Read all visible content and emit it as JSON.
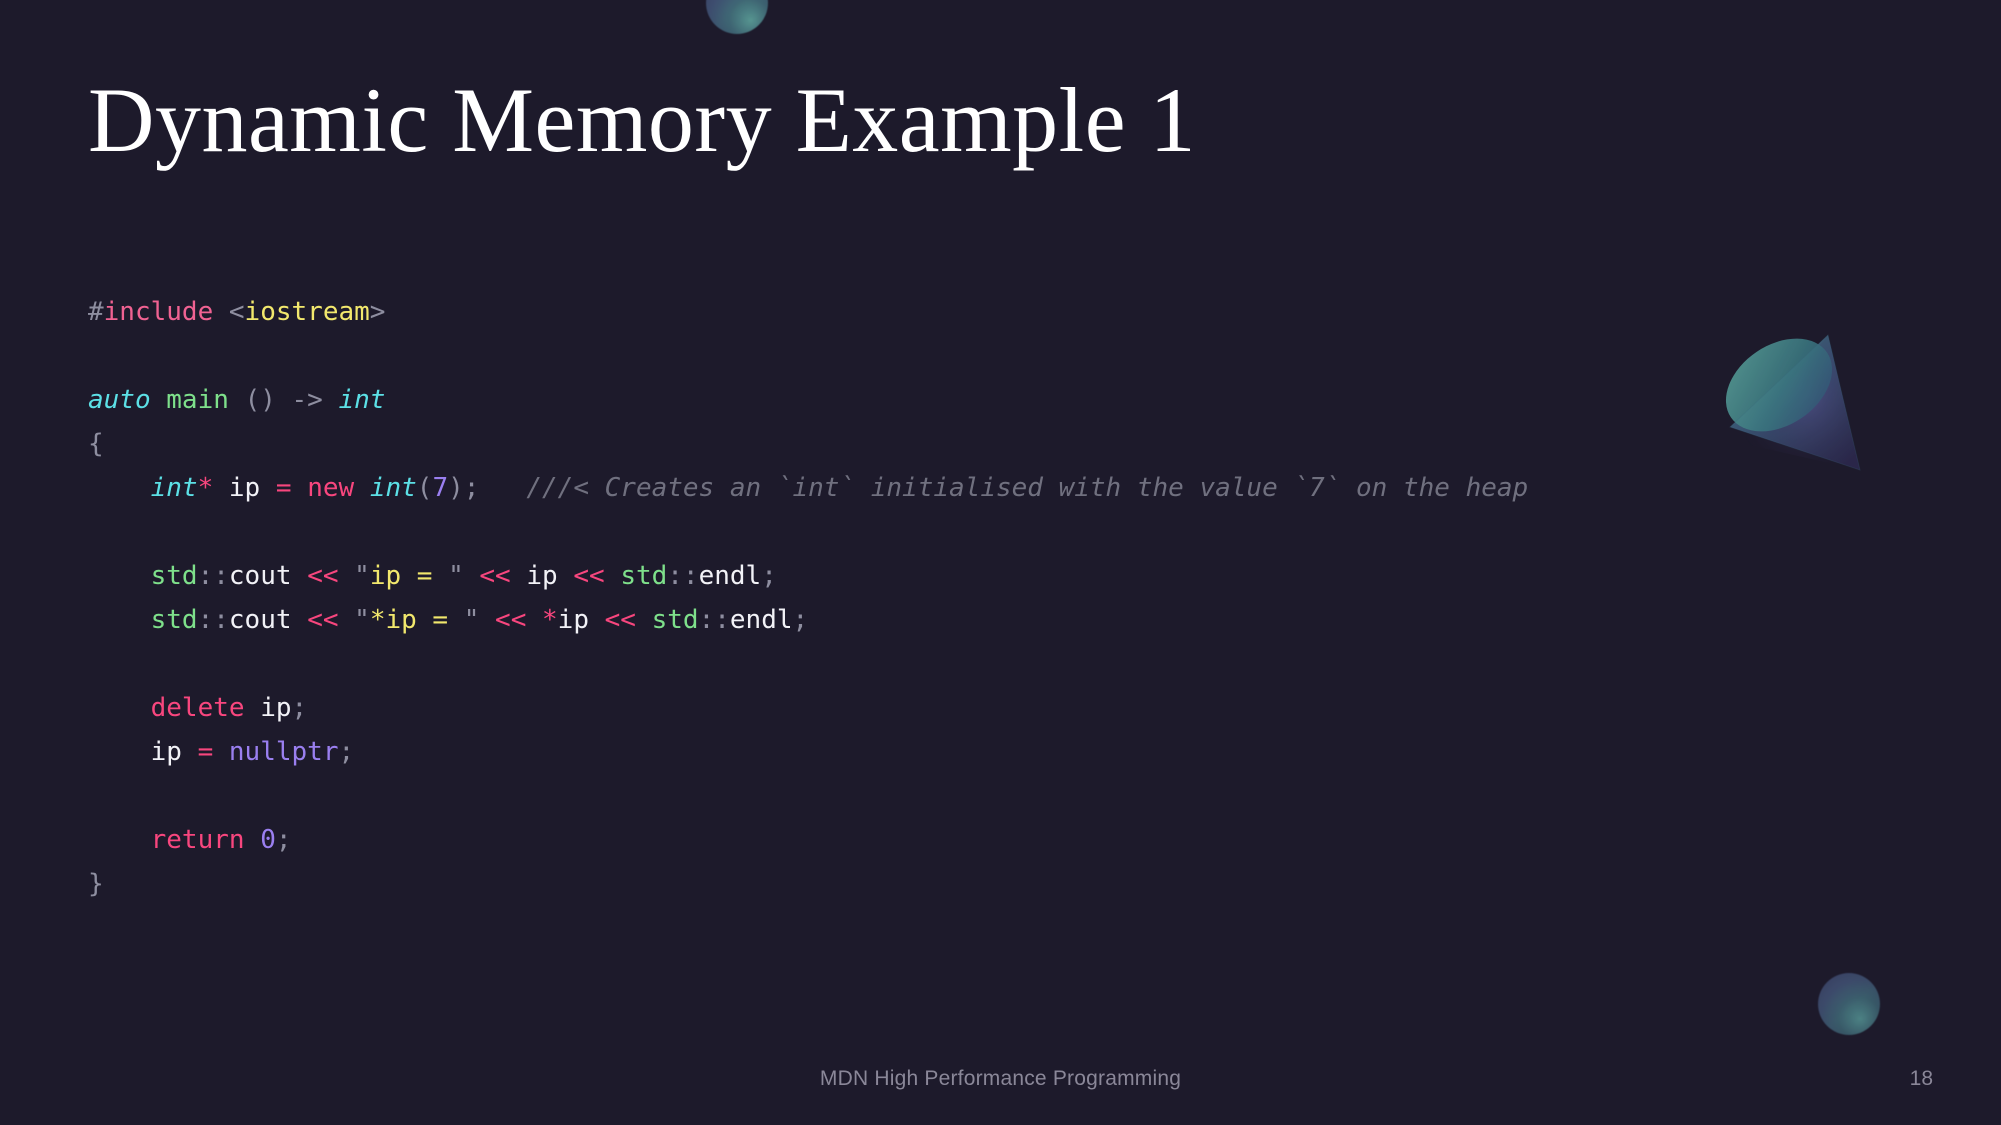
{
  "slide": {
    "title": "Dynamic Memory Example 1",
    "background_color": "#1d1a2b",
    "title_color": "#ffffff"
  },
  "code": {
    "language": "cpp",
    "lines": [
      {
        "tokens": [
          {
            "text": "#",
            "cls": "t-hash"
          },
          {
            "text": "include",
            "cls": "t-pre"
          },
          {
            "text": " ",
            "cls": "t-punct"
          },
          {
            "text": "<",
            "cls": "t-punct"
          },
          {
            "text": "iostream",
            "cls": "t-string"
          },
          {
            "text": ">",
            "cls": "t-punct"
          }
        ]
      },
      {
        "tokens": []
      },
      {
        "tokens": [
          {
            "text": "auto",
            "cls": "t-type"
          },
          {
            "text": " ",
            "cls": "t-punct"
          },
          {
            "text": "main",
            "cls": "t-fn"
          },
          {
            "text": " ",
            "cls": "t-punct"
          },
          {
            "text": "()",
            "cls": "t-punct"
          },
          {
            "text": " ",
            "cls": "t-punct"
          },
          {
            "text": "->",
            "cls": "t-punct"
          },
          {
            "text": " ",
            "cls": "t-punct"
          },
          {
            "text": "int",
            "cls": "t-type"
          }
        ]
      },
      {
        "tokens": [
          {
            "text": "{",
            "cls": "t-punct"
          }
        ]
      },
      {
        "tokens": [
          {
            "text": "    ",
            "cls": "t-punct"
          },
          {
            "text": "int",
            "cls": "t-type"
          },
          {
            "text": "*",
            "cls": "t-op"
          },
          {
            "text": " ",
            "cls": "t-punct"
          },
          {
            "text": "ip",
            "cls": "t-var"
          },
          {
            "text": " ",
            "cls": "t-punct"
          },
          {
            "text": "=",
            "cls": "t-op"
          },
          {
            "text": " ",
            "cls": "t-punct"
          },
          {
            "text": "new",
            "cls": "t-kw"
          },
          {
            "text": " ",
            "cls": "t-punct"
          },
          {
            "text": "int",
            "cls": "t-type"
          },
          {
            "text": "(",
            "cls": "t-punct"
          },
          {
            "text": "7",
            "cls": "t-num"
          },
          {
            "text": ");",
            "cls": "t-punct"
          },
          {
            "text": "   ",
            "cls": "t-punct"
          },
          {
            "text": "///< Creates an `int` initialised with the value `7` on the heap",
            "cls": "t-comment"
          }
        ]
      },
      {
        "tokens": []
      },
      {
        "tokens": [
          {
            "text": "    ",
            "cls": "t-punct"
          },
          {
            "text": "std",
            "cls": "t-ns"
          },
          {
            "text": "::",
            "cls": "t-punct"
          },
          {
            "text": "cout",
            "cls": "t-var"
          },
          {
            "text": " ",
            "cls": "t-punct"
          },
          {
            "text": "<<",
            "cls": "t-op"
          },
          {
            "text": " ",
            "cls": "t-punct"
          },
          {
            "text": "\"",
            "cls": "t-punct"
          },
          {
            "text": "ip = ",
            "cls": "t-string"
          },
          {
            "text": "\"",
            "cls": "t-punct"
          },
          {
            "text": " ",
            "cls": "t-punct"
          },
          {
            "text": "<<",
            "cls": "t-op"
          },
          {
            "text": " ",
            "cls": "t-punct"
          },
          {
            "text": "ip",
            "cls": "t-var"
          },
          {
            "text": " ",
            "cls": "t-punct"
          },
          {
            "text": "<<",
            "cls": "t-op"
          },
          {
            "text": " ",
            "cls": "t-punct"
          },
          {
            "text": "std",
            "cls": "t-ns"
          },
          {
            "text": "::",
            "cls": "t-punct"
          },
          {
            "text": "endl",
            "cls": "t-var"
          },
          {
            "text": ";",
            "cls": "t-punct"
          }
        ]
      },
      {
        "tokens": [
          {
            "text": "    ",
            "cls": "t-punct"
          },
          {
            "text": "std",
            "cls": "t-ns"
          },
          {
            "text": "::",
            "cls": "t-punct"
          },
          {
            "text": "cout",
            "cls": "t-var"
          },
          {
            "text": " ",
            "cls": "t-punct"
          },
          {
            "text": "<<",
            "cls": "t-op"
          },
          {
            "text": " ",
            "cls": "t-punct"
          },
          {
            "text": "\"",
            "cls": "t-punct"
          },
          {
            "text": "*ip = ",
            "cls": "t-string"
          },
          {
            "text": "\"",
            "cls": "t-punct"
          },
          {
            "text": " ",
            "cls": "t-punct"
          },
          {
            "text": "<<",
            "cls": "t-op"
          },
          {
            "text": " ",
            "cls": "t-punct"
          },
          {
            "text": "*",
            "cls": "t-op"
          },
          {
            "text": "ip",
            "cls": "t-var"
          },
          {
            "text": " ",
            "cls": "t-punct"
          },
          {
            "text": "<<",
            "cls": "t-op"
          },
          {
            "text": " ",
            "cls": "t-punct"
          },
          {
            "text": "std",
            "cls": "t-ns"
          },
          {
            "text": "::",
            "cls": "t-punct"
          },
          {
            "text": "endl",
            "cls": "t-var"
          },
          {
            "text": ";",
            "cls": "t-punct"
          }
        ]
      },
      {
        "tokens": []
      },
      {
        "tokens": [
          {
            "text": "    ",
            "cls": "t-punct"
          },
          {
            "text": "delete",
            "cls": "t-kw"
          },
          {
            "text": " ",
            "cls": "t-punct"
          },
          {
            "text": "ip",
            "cls": "t-var"
          },
          {
            "text": ";",
            "cls": "t-punct"
          }
        ]
      },
      {
        "tokens": [
          {
            "text": "    ",
            "cls": "t-punct"
          },
          {
            "text": "ip",
            "cls": "t-var"
          },
          {
            "text": " ",
            "cls": "t-punct"
          },
          {
            "text": "=",
            "cls": "t-op"
          },
          {
            "text": " ",
            "cls": "t-punct"
          },
          {
            "text": "nullptr",
            "cls": "t-num"
          },
          {
            "text": ";",
            "cls": "t-punct"
          }
        ]
      },
      {
        "tokens": []
      },
      {
        "tokens": [
          {
            "text": "    ",
            "cls": "t-punct"
          },
          {
            "text": "return",
            "cls": "t-kw"
          },
          {
            "text": " ",
            "cls": "t-punct"
          },
          {
            "text": "0",
            "cls": "t-num"
          },
          {
            "text": ";",
            "cls": "t-punct"
          }
        ]
      },
      {
        "tokens": [
          {
            "text": "}",
            "cls": "t-punct"
          }
        ]
      }
    ]
  },
  "footer": {
    "text": "MDN High Performance Programming",
    "page_number": "18"
  },
  "decorations": {
    "cone": {
      "name": "cone-shape",
      "gradient_from": "#4f9a94",
      "gradient_to": "#3a3366"
    },
    "sphere_top": {
      "name": "sphere-shape",
      "gradient_from": "#4d5b86",
      "gradient_to": "#2b3350"
    },
    "sphere_bottom": {
      "name": "sphere-shape",
      "gradient_from": "#4a5680",
      "gradient_to": "#272f4a"
    }
  }
}
